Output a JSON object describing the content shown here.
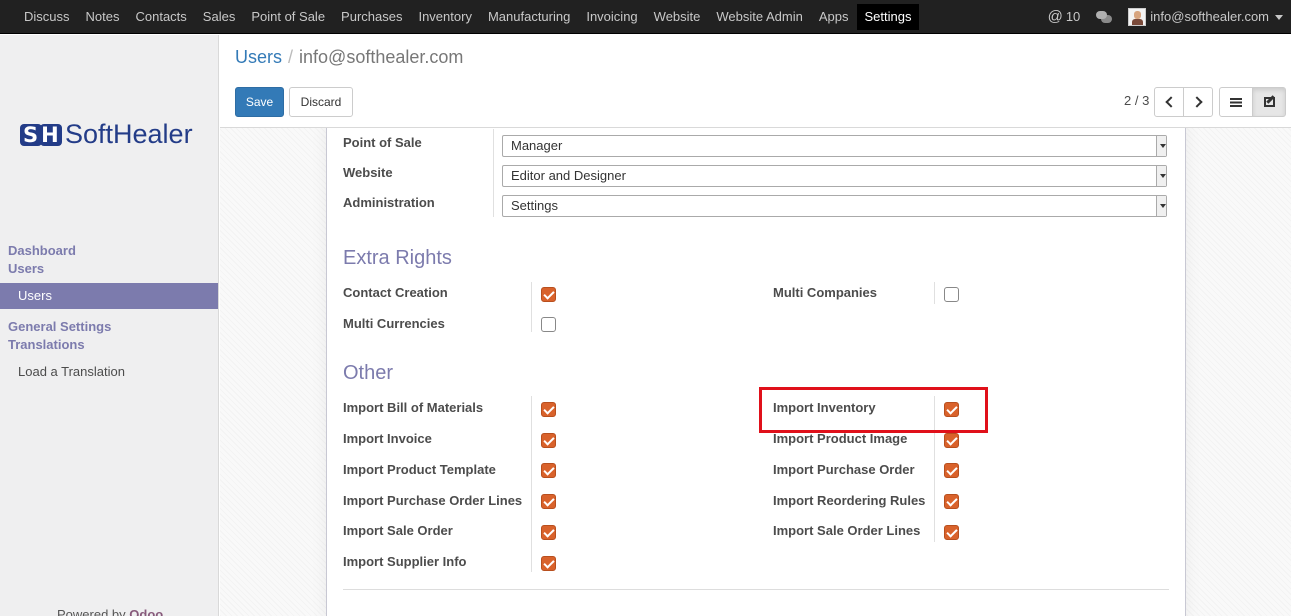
{
  "topbar": {
    "menu": [
      "Discuss",
      "Notes",
      "Contacts",
      "Sales",
      "Point of Sale",
      "Purchases",
      "Inventory",
      "Manufacturing",
      "Invoicing",
      "Website",
      "Website Admin",
      "Apps",
      "Settings"
    ],
    "active_menu": "Settings",
    "mentions_count": "10",
    "user_email": "info@softhealer.com"
  },
  "sidebar": {
    "logo_text": "SoftHealer",
    "logo_mark": "SH",
    "section_dashboard": "Dashboard",
    "section_users": "Users",
    "item_users": "Users",
    "section_general": "General Settings",
    "section_translations": "Translations",
    "item_load_translation": "Load a Translation",
    "powered_prefix": "Powered by",
    "powered_brand": "Odoo"
  },
  "control_panel": {
    "breadcrumb_parent": "Users",
    "breadcrumb_separator": "/",
    "breadcrumb_current": "info@softhealer.com",
    "save_label": "Save",
    "discard_label": "Discard",
    "pager": "2 / 3"
  },
  "form": {
    "access_rows": [
      {
        "label": "Point of Sale",
        "value": "Manager"
      },
      {
        "label": "Website",
        "value": "Editor and Designer"
      },
      {
        "label": "Administration",
        "value": "Settings"
      }
    ],
    "extra_rights_title": "Extra Rights",
    "extra_rights": [
      {
        "label": "Contact Creation",
        "checked": true
      },
      {
        "label": "Multi Companies",
        "checked": false
      },
      {
        "label": "Multi Currencies",
        "checked": false
      }
    ],
    "other_title": "Other",
    "other_left": [
      {
        "label": "Import Bill of Materials",
        "checked": true
      },
      {
        "label": "Import Invoice",
        "checked": true
      },
      {
        "label": "Import Product Template",
        "checked": true
      },
      {
        "label": "Import Purchase Order Lines",
        "checked": true
      },
      {
        "label": "Import Sale Order",
        "checked": true
      },
      {
        "label": "Import Supplier Info",
        "checked": true
      }
    ],
    "other_right": [
      {
        "label": "Import Inventory",
        "checked": true
      },
      {
        "label": "Import Product Image",
        "checked": true
      },
      {
        "label": "Import Purchase Order",
        "checked": true
      },
      {
        "label": "Import Reordering Rules",
        "checked": true
      },
      {
        "label": "Import Sale Order Lines",
        "checked": true
      }
    ]
  },
  "colors": {
    "accent": "#7c7bad",
    "primary_button": "#337ab7",
    "checkbox": "#d9622b",
    "highlight": "#e0101a"
  }
}
